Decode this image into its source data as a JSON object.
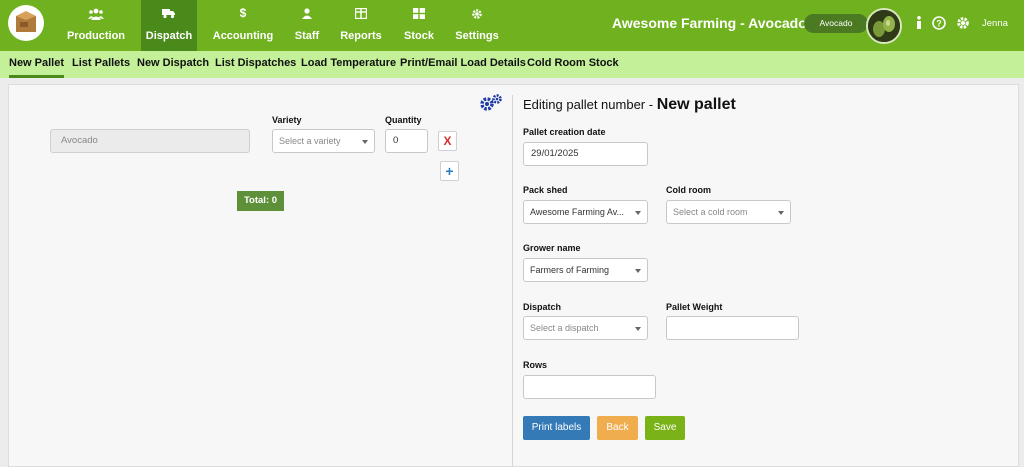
{
  "nav": {
    "items": [
      {
        "label": "Production",
        "icon": "users-icon"
      },
      {
        "label": "Dispatch",
        "icon": "truck-icon"
      },
      {
        "label": "Accounting",
        "icon": "dollar-icon"
      },
      {
        "label": "Staff",
        "icon": "person-icon"
      },
      {
        "label": "Reports",
        "icon": "report-icon"
      },
      {
        "label": "Stock",
        "icon": "grid-icon"
      },
      {
        "label": "Settings",
        "icon": "gear-icon"
      }
    ],
    "active": "Dispatch",
    "brand": "Awesome Farming - Avocados",
    "crop": "Avocado",
    "user": "Jenna",
    "accent": "#6fb11f"
  },
  "subnav": {
    "items": [
      "New Pallet",
      "List Pallets",
      "New Dispatch",
      "List Dispatches",
      "Load Temperature",
      "Print/Email Load Details",
      "Cold Room Stock"
    ],
    "active": "New Pallet"
  },
  "left": {
    "product": "Avocado",
    "variety_label": "Variety",
    "variety_placeholder": "Select a variety",
    "quantity_label": "Quantity",
    "quantity_value": "0",
    "remove": "X",
    "add": "+",
    "total": "Total: 0"
  },
  "form": {
    "title_prefix": "Editing pallet number - ",
    "title_main": "New pallet",
    "creation_date_label": "Pallet creation date",
    "creation_date": "29/01/2025",
    "packshed_label": "Pack shed",
    "packshed_value": "Awesome Farming Av...",
    "coldroom_label": "Cold room",
    "coldroom_placeholder": "Select a cold room",
    "grower_label": "Grower name",
    "grower_value": "Farmers of Farming",
    "dispatch_label": "Dispatch",
    "dispatch_placeholder": "Select a dispatch",
    "weight_label": "Pallet Weight",
    "weight_value": "",
    "rows_label": "Rows",
    "rows_value": ""
  },
  "buttons": {
    "print": "Print labels",
    "back": "Back",
    "save": "Save",
    "print_color": "#337ab7",
    "back_color": "#f0ad4e",
    "save_color": "#7ab317"
  }
}
